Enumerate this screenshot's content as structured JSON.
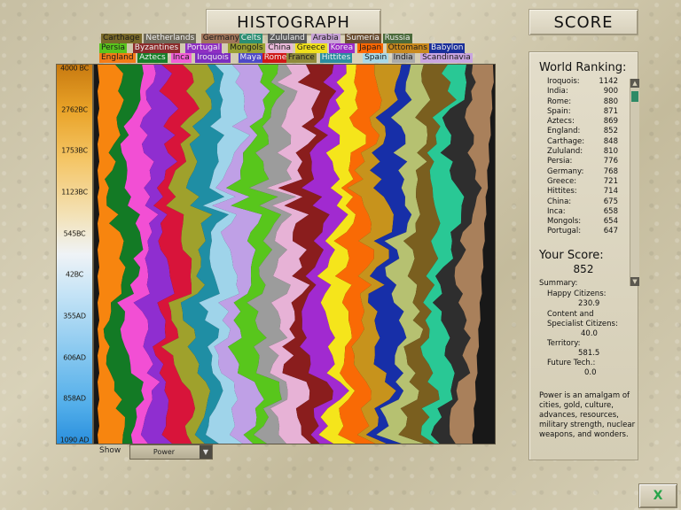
{
  "titles": {
    "histograph": "HISTOGRAPH",
    "score": "SCORE"
  },
  "legend": [
    {
      "name": "Carthage",
      "color": "#7a6a2a",
      "text": "#1a1a1a"
    },
    {
      "name": "Netherlands",
      "color": "#6f6a5a",
      "text": "#f0f0f0"
    },
    {
      "name": "Germany",
      "color": "#a0755a",
      "text": "#1a1a1a"
    },
    {
      "name": "Celts",
      "color": "#2c8f73",
      "text": "#f0f0f0"
    },
    {
      "name": "Zululand",
      "color": "#5a5a5a",
      "text": "#f0f0f0"
    },
    {
      "name": "Arabia",
      "color": "#c8a3d6",
      "text": "#1a1a1a"
    },
    {
      "name": "Sumeria",
      "color": "#6b4f33",
      "text": "#f0f0f0"
    },
    {
      "name": "Russia",
      "color": "#4a6a3a",
      "text": "#f0f0f0"
    },
    {
      "name": "Persia",
      "color": "#59c51d",
      "text": "#1a1a1a"
    },
    {
      "name": "Byzantines",
      "color": "#8b2b2b",
      "text": "#f0f0f0"
    },
    {
      "name": "Portugal",
      "color": "#8e2fc2",
      "text": "#f0f0f0"
    },
    {
      "name": "Mongols",
      "color": "#9aa033",
      "text": "#1a1a1a"
    },
    {
      "name": "China",
      "color": "#e8b9d8",
      "text": "#1a1a1a"
    },
    {
      "name": "Greece",
      "color": "#f0e01b",
      "text": "#1a1a1a"
    },
    {
      "name": "Korea",
      "color": "#9b2bc7",
      "text": "#f0f0f0"
    },
    {
      "name": "Japan",
      "color": "#ff6600",
      "text": "#1a1a1a"
    },
    {
      "name": "Ottomans",
      "color": "#c98a1e",
      "text": "#1a1a1a"
    },
    {
      "name": "Babylon",
      "color": "#1a2f9a",
      "text": "#f0f0f0"
    },
    {
      "name": "England",
      "color": "#f47b17",
      "text": "#1a1a1a"
    },
    {
      "name": "Aztecs",
      "color": "#187f2a",
      "text": "#f0f0f0"
    },
    {
      "name": "Inca",
      "color": "#f05fd5",
      "text": "#1a1a1a"
    },
    {
      "name": "Iroquois",
      "color": "#7c2dc0",
      "text": "#f0f0f0"
    },
    {
      "name": "Maya",
      "color": "#4e49c8",
      "text": "#f0f0f0"
    },
    {
      "name": "Rome",
      "color": "#d01616",
      "text": "#f0f0f0"
    },
    {
      "name": "France",
      "color": "#8f8a3a",
      "text": "#1a1a1a"
    },
    {
      "name": "Hittites",
      "color": "#2a8ea0",
      "text": "#f0f0f0"
    },
    {
      "name": "Spain",
      "color": "#a8d8e8",
      "text": "#1a1a1a"
    },
    {
      "name": "India",
      "color": "#aaaaaa",
      "text": "#1a1a1a"
    },
    {
      "name": "Scandinavia",
      "color": "#c9a5e0",
      "text": "#1a1a1a"
    }
  ],
  "year_labels": [
    "4000 BC",
    "2762BC",
    "1753BC",
    "1123BC",
    "545BC",
    "42BC",
    "355AD",
    "606AD",
    "858AD",
    "1090 AD"
  ],
  "streams": [
    {
      "name": "England",
      "color": "#f7850f"
    },
    {
      "name": "Aztecs",
      "color": "#137a25"
    },
    {
      "name": "Inca",
      "color": "#f24fd4"
    },
    {
      "name": "Portugal",
      "color": "#8f2ed0"
    },
    {
      "name": "Rome",
      "color": "#d8143a"
    },
    {
      "name": "Mongols",
      "color": "#9fa12c"
    },
    {
      "name": "Hittites",
      "color": "#1f8ea4"
    },
    {
      "name": "Spain",
      "color": "#9fd4ea"
    },
    {
      "name": "Scandinavia",
      "color": "#bfa0e6"
    },
    {
      "name": "Persia",
      "color": "#58c61c"
    },
    {
      "name": "India",
      "color": "#9c9c9c"
    },
    {
      "name": "China",
      "color": "#e7b2d6"
    },
    {
      "name": "Byzantines",
      "color": "#8a1d1d"
    },
    {
      "name": "Korea",
      "color": "#a12ad0"
    },
    {
      "name": "Greece",
      "color": "#f5e51b"
    },
    {
      "name": "Japan",
      "color": "#f96a05"
    },
    {
      "name": "Ottomans",
      "color": "#c7931c"
    },
    {
      "name": "Babylon",
      "color": "#172fa8"
    },
    {
      "name": "Mongols-2",
      "color": "#b6c171"
    },
    {
      "name": "Carthage",
      "color": "#7a5f1f"
    },
    {
      "name": "Celts",
      "color": "#29c895"
    },
    {
      "name": "Zululand",
      "color": "#2e2e2e"
    },
    {
      "name": "Germany",
      "color": "#a9805b"
    }
  ],
  "show": {
    "label": "Show",
    "value": "Power"
  },
  "ranking": {
    "title": "World Ranking:",
    "rows": [
      {
        "name": "Iroquois:",
        "value": "1142"
      },
      {
        "name": "India:",
        "value": "900"
      },
      {
        "name": "Rome:",
        "value": "880"
      },
      {
        "name": "Spain:",
        "value": "871"
      },
      {
        "name": "Aztecs:",
        "value": "869"
      },
      {
        "name": "England:",
        "value": "852"
      },
      {
        "name": "Carthage:",
        "value": "848"
      },
      {
        "name": "Zululand:",
        "value": "810"
      },
      {
        "name": "Persia:",
        "value": "776"
      },
      {
        "name": "Germany:",
        "value": "768"
      },
      {
        "name": "Greece:",
        "value": "721"
      },
      {
        "name": "Hittites:",
        "value": "714"
      },
      {
        "name": "China:",
        "value": "675"
      },
      {
        "name": "Inca:",
        "value": "658"
      },
      {
        "name": "Mongols:",
        "value": "654"
      },
      {
        "name": "Portugal:",
        "value": "647"
      }
    ]
  },
  "your_score": {
    "title": "Your Score:",
    "value": "852",
    "summary_label": "Summary:",
    "happy_label": "Happy Citizens:",
    "happy_value": "230.9",
    "content_label_1": "Content and",
    "content_label_2": "Specialist Citizens:",
    "content_value": "40.0",
    "territory_label": "Territory:",
    "territory_value": "581.5",
    "future_label": "Future Tech.:",
    "future_value": "0.0"
  },
  "description": "Power is an amalgam of cities, gold, culture, advances, resources, military strength, nuclear weapons, and wonders.",
  "close_label": "X"
}
